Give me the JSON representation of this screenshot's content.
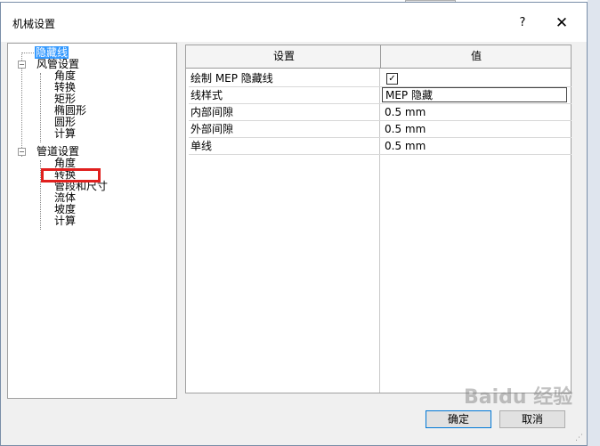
{
  "window": {
    "title": "机械设置",
    "help_label": "?",
    "close_label": "✕"
  },
  "tree": {
    "items": [
      {
        "label": "隐藏线",
        "level": 0,
        "selected": true
      },
      {
        "label": "风管设置",
        "level": 0,
        "expander": "−"
      },
      {
        "label": "角度",
        "level": 1
      },
      {
        "label": "转换",
        "level": 1
      },
      {
        "label": "矩形",
        "level": 1
      },
      {
        "label": "椭圆形",
        "level": 1
      },
      {
        "label": "圆形",
        "level": 1
      },
      {
        "label": "计算",
        "level": 1
      },
      {
        "label": "管道设置",
        "level": 0,
        "expander": "−"
      },
      {
        "label": "角度",
        "level": 1
      },
      {
        "label": "转换",
        "level": 1,
        "highlighted": true
      },
      {
        "label": "管段和尺寸",
        "level": 1
      },
      {
        "label": "流体",
        "level": 1
      },
      {
        "label": "坡度",
        "level": 1
      },
      {
        "label": "计算",
        "level": 1
      }
    ]
  },
  "grid": {
    "headers": {
      "setting": "设置",
      "value": "值"
    },
    "rows": [
      {
        "name": "绘制 MEP 隐藏线",
        "value": "",
        "checkbox": true,
        "checked_mark": "✓"
      },
      {
        "name": "线样式",
        "value": "MEP 隐藏",
        "editing": true
      },
      {
        "name": "内部间隙",
        "value": "0.5 mm"
      },
      {
        "name": "外部间隙",
        "value": "0.5 mm"
      },
      {
        "name": "单线",
        "value": "0.5 mm"
      }
    ]
  },
  "buttons": {
    "ok": "确定",
    "cancel": "取消"
  },
  "watermark": "Baidu 经验"
}
